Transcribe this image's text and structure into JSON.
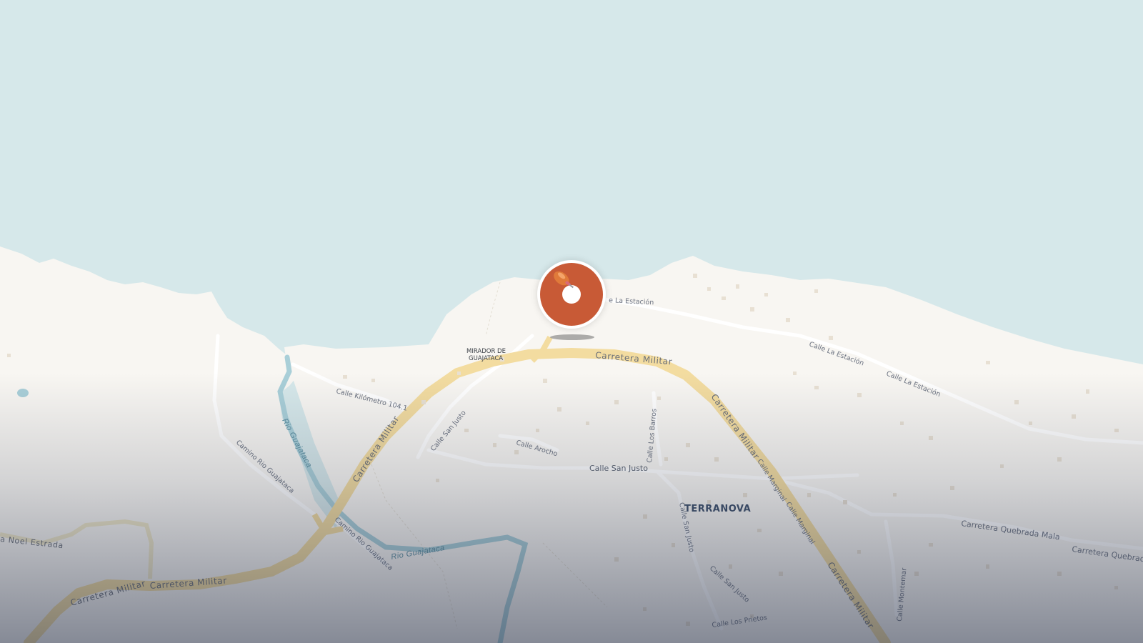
{
  "map": {
    "colors": {
      "water": "#d6e8ea",
      "land": "#f8f6f2",
      "main_road": "#f3dca0",
      "minor_road": "#ffffff",
      "river": "#a9cfd8",
      "marker": "#c85a36"
    },
    "main_roads": [
      {
        "name": "Carretera Militar"
      }
    ],
    "labels": {
      "carretera_militar_1": "Carretera Militar",
      "carretera_militar_2": "Carretera Militar",
      "carretera_militar_3": "Carretera Militar",
      "carretera_militar_4": "Carretera Militar",
      "carretera_militar_5": "Carretera Militar",
      "calle_la_estacion_1": "e La Estación",
      "calle_la_estacion_2": "Calle La Estación",
      "calle_la_estacion_3": "Calle La Estación",
      "calle_km": "Calle Kilómetro 104.1",
      "calle_san_justo_1": "Calle San Justo",
      "calle_san_justo_2": "Calle San Justo",
      "calle_san_justo_3": "Calle San Justo",
      "calle_san_justo_4": "Calle San Justo",
      "calle_arocho": "Calle Arocho",
      "calle_los_barros": "Calle Los Barros",
      "calle_marginal_1": "Calle Marginal",
      "calle_marginal_2": "Calle Marginal",
      "camino_rio_1": "Camino Rio Guajataca",
      "camino_rio_2": "Camino Rio Guajataca",
      "rio_1": "Rio Guajataca",
      "rio_2": "Rio Guajataca",
      "noel_estrada": "a Noel Estrada",
      "quebrada_mala_1": "Carretera Quebrada Mala",
      "quebrada_mala_2": "Carretera Quebrad",
      "calle_montemar": "Calle Montemar",
      "calle_los_prietos": "Calle Los Prietos",
      "terranova": "TERRANOVA",
      "mirador_line1": "MIRADOR DE",
      "mirador_line2": "GUAJATACA"
    },
    "marker": {
      "icon": "map-pin-icon"
    }
  }
}
